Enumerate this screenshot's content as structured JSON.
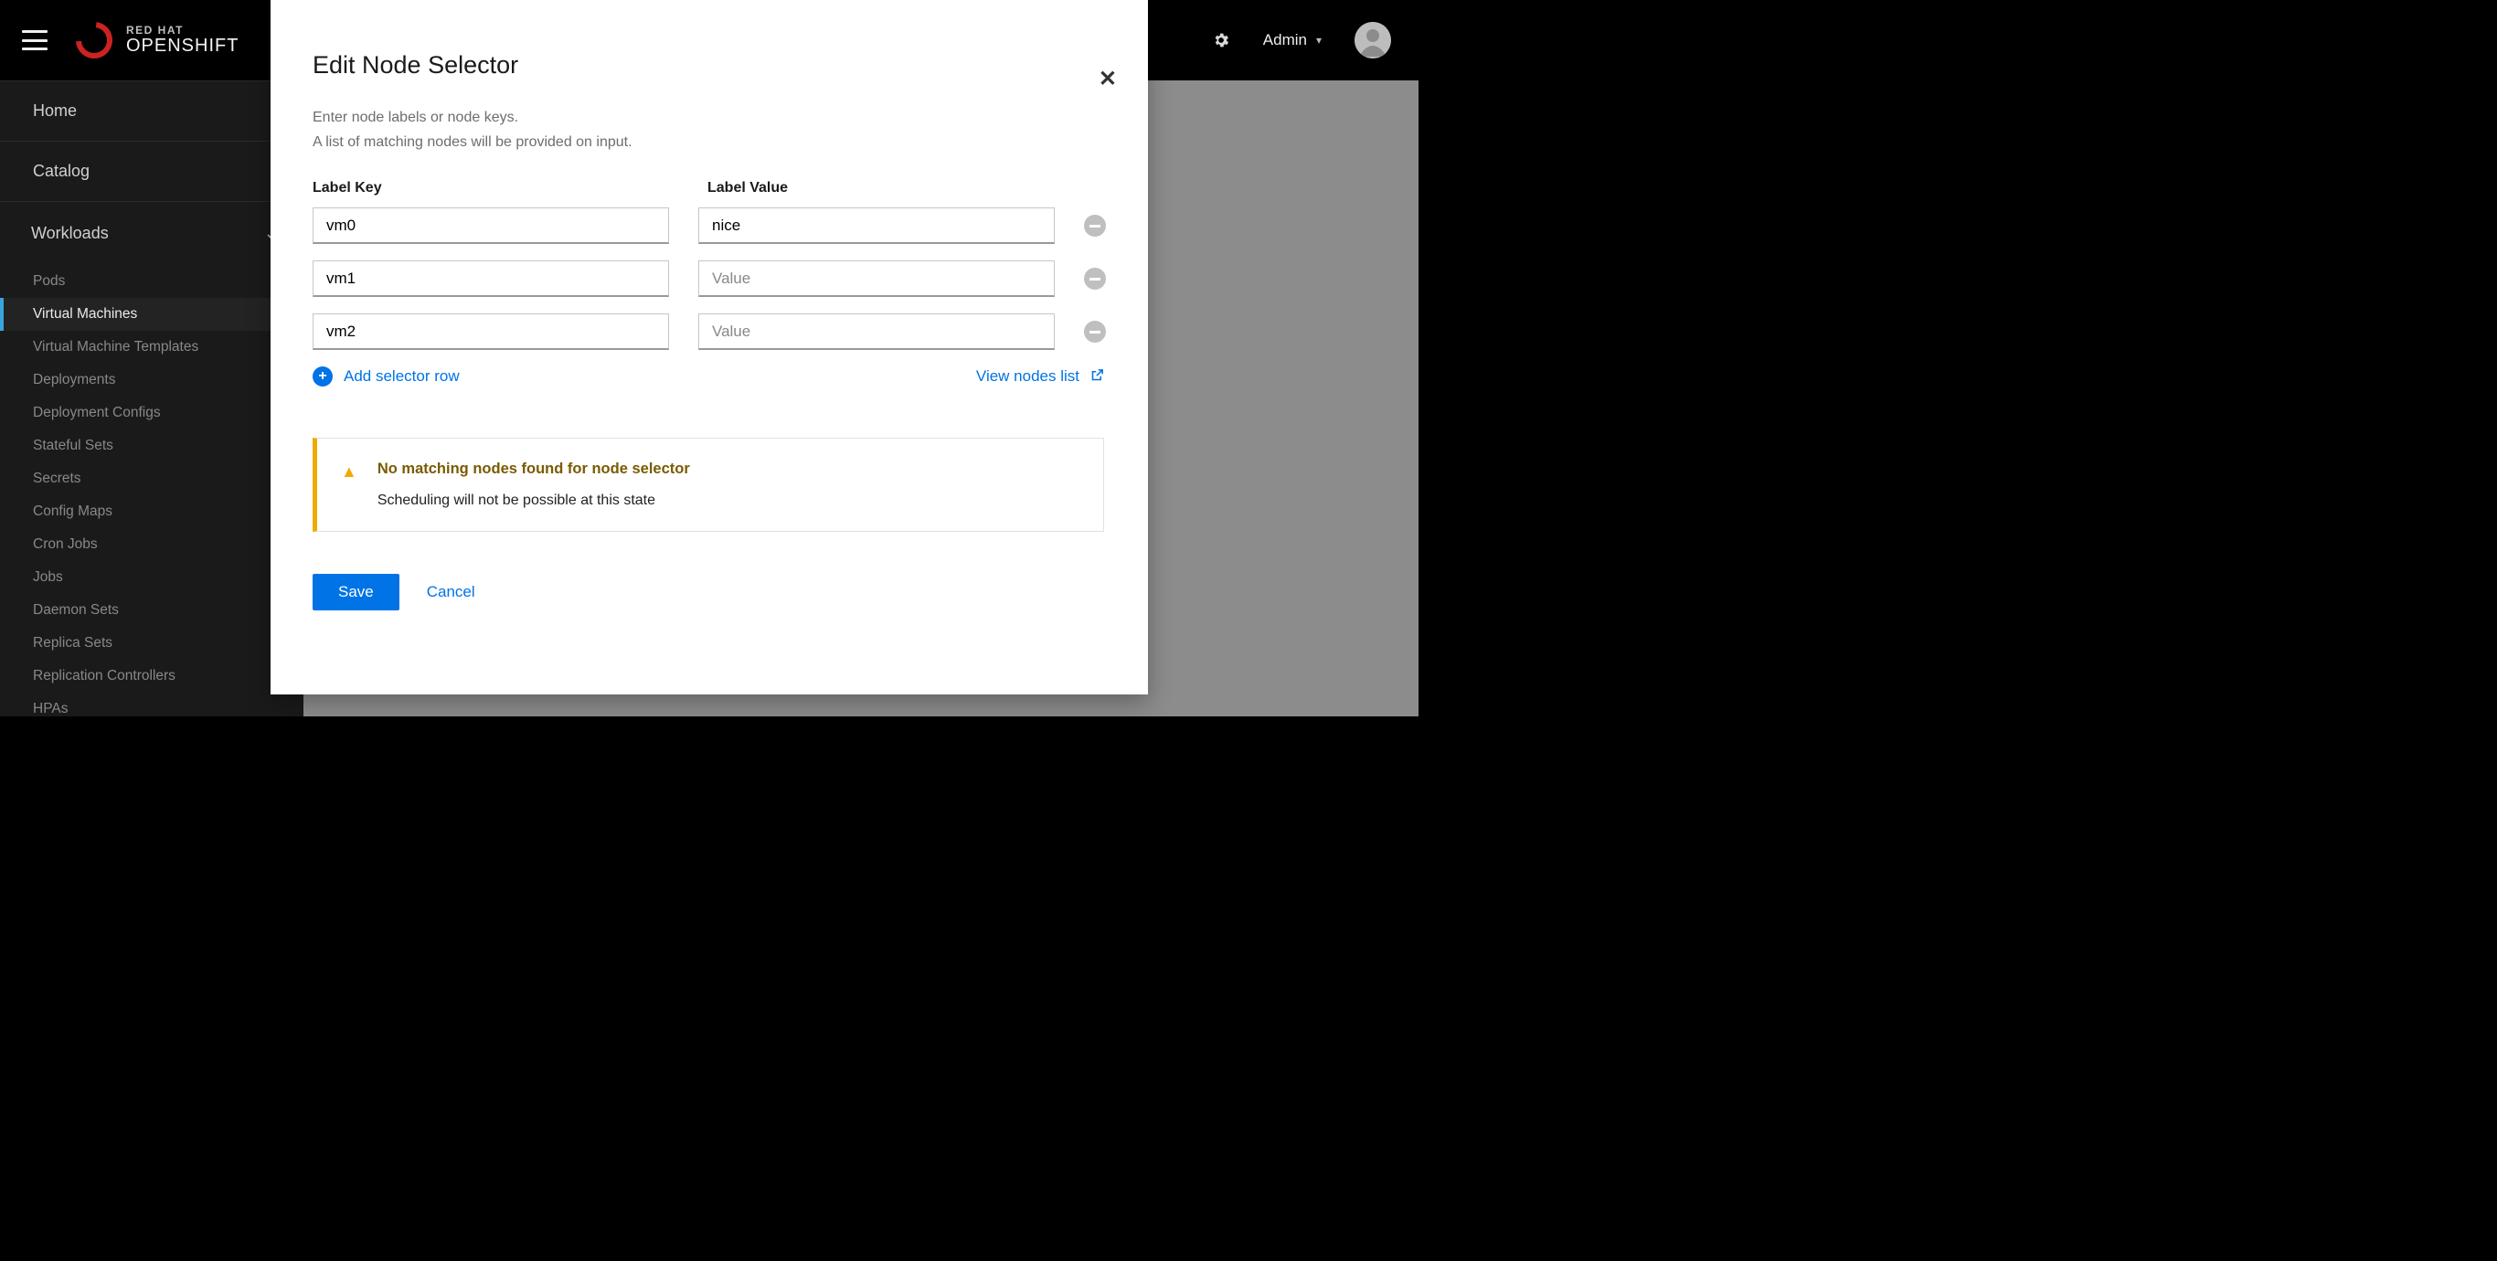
{
  "brand": {
    "top": "RED HAT",
    "bottom": "OPENSHIFT"
  },
  "topbar": {
    "admin_label": "Admin"
  },
  "sidebar": {
    "top": [
      {
        "label": "Home"
      },
      {
        "label": "Catalog"
      }
    ],
    "workloads_label": "Workloads",
    "workloads_children": [
      {
        "label": "Pods"
      },
      {
        "label": "Virtual Machines",
        "active": true
      },
      {
        "label": "Virtual Machine Templates"
      },
      {
        "label": "Deployments"
      },
      {
        "label": "Deployment Configs"
      },
      {
        "label": "Stateful Sets"
      },
      {
        "label": "Secrets"
      },
      {
        "label": "Config Maps"
      },
      {
        "label": "Cron Jobs"
      },
      {
        "label": "Jobs"
      },
      {
        "label": "Daemon Sets"
      },
      {
        "label": "Replica Sets"
      },
      {
        "label": "Replication Controllers"
      },
      {
        "label": "HPAs"
      }
    ]
  },
  "modal": {
    "title": "Edit Node Selector",
    "desc_line1": "Enter node labels or node keys.",
    "desc_line2": "A list of matching nodes will be provided on input.",
    "col_key": "Label Key",
    "col_val": "Label Value",
    "value_placeholder": "Value",
    "rows": [
      {
        "key": "vm0",
        "value": "nice"
      },
      {
        "key": "vm1",
        "value": ""
      },
      {
        "key": "vm2",
        "value": ""
      }
    ],
    "add_row": "Add selector row",
    "view_nodes": "View nodes list",
    "alert_title": "No matching nodes found for node selector",
    "alert_body": "Scheduling will not be possible at this state",
    "save": "Save",
    "cancel": "Cancel"
  }
}
